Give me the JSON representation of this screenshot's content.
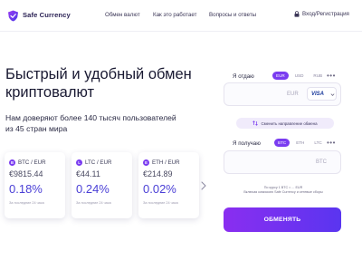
{
  "header": {
    "brand": "Safe Currency",
    "nav": [
      "Обмен валют",
      "Как это работает",
      "Вопросы и ответы"
    ],
    "login_label": "Вход/Регистрация"
  },
  "hero": {
    "title": "Быстрый и удобный обмен криптовалют",
    "subtitle": "Нам доверяют более 140 тысяч пользователей из 45 стран мира"
  },
  "rates": [
    {
      "coin_letter": "B",
      "pair": "BTC / EUR",
      "price": "€9815.44",
      "change": "0.18%",
      "note": "За последние 24 часа"
    },
    {
      "coin_letter": "L",
      "pair": "LTC / EUR",
      "price": "€44.11",
      "change": "0.24%",
      "note": "За последние 24 часа"
    },
    {
      "coin_letter": "E",
      "pair": "ETH / EUR",
      "price": "€214.89",
      "change": "0.02%",
      "note": "За последние 24 часа"
    }
  ],
  "exchange": {
    "give_label": "Я отдаю",
    "give_tabs": [
      "EUR",
      "USD",
      "RUB"
    ],
    "give_currency": "EUR",
    "payment_method": "VISA",
    "swap_label": "Сменить направление обмена",
    "get_label": "Я получаю",
    "get_tabs": [
      "BTC",
      "ETH",
      "LTC"
    ],
    "get_currency": "BTC",
    "more": "•••",
    "rate_info": "По курсу 1 BTC = ... EUR",
    "fee_info": "Включая комиссию Safe Currency и сетевые сборы",
    "submit_label": "ОБМЕНЯТЬ"
  },
  "colors": {
    "accent": "#7a3cf0",
    "accent_2": "#5a35f0",
    "change_text": "#4a3fd6"
  },
  "icons": {
    "logo": "shield-logo-icon",
    "login": "lock-icon",
    "swap": "swap-arrows-icon",
    "carousel_next": "chevron-right-icon",
    "dropdown": "chevron-down-icon"
  }
}
